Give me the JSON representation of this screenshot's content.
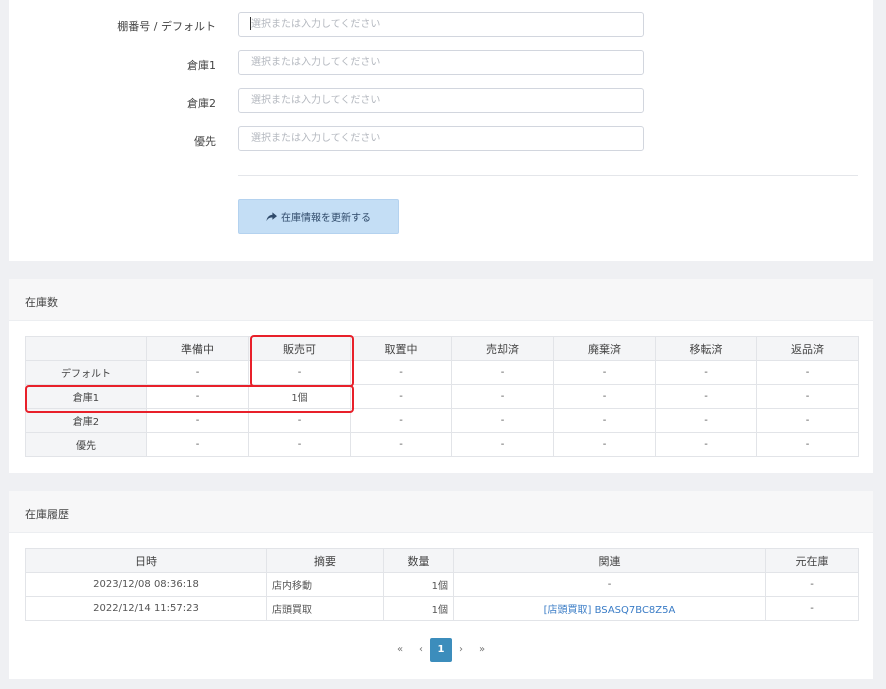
{
  "form": {
    "fields": [
      {
        "label": "棚番号 / デフォルト",
        "placeholder": "選択または入力してください",
        "value": ""
      },
      {
        "label": "倉庫1",
        "placeholder": "選択または入力してください",
        "value": ""
      },
      {
        "label": "倉庫2",
        "placeholder": "選択または入力してください",
        "value": ""
      },
      {
        "label": "優先",
        "placeholder": "選択または入力してください",
        "value": ""
      }
    ],
    "update_button": {
      "label": "在庫情報を更新する",
      "icon": "share-arrow-icon"
    }
  },
  "stock": {
    "title": "在庫数",
    "columns": [
      "",
      "準備中",
      "販売可",
      "取置中",
      "売却済",
      "廃棄済",
      "移転済",
      "返品済"
    ],
    "rows": [
      {
        "label": "デフォルト",
        "cells": [
          "-",
          "-",
          "-",
          "-",
          "-",
          "-",
          "-"
        ]
      },
      {
        "label": "倉庫1",
        "cells": [
          "-",
          "1個",
          "-",
          "-",
          "-",
          "-",
          "-"
        ]
      },
      {
        "label": "倉庫2",
        "cells": [
          "-",
          "-",
          "-",
          "-",
          "-",
          "-",
          "-"
        ]
      },
      {
        "label": "優先",
        "cells": [
          "-",
          "-",
          "-",
          "-",
          "-",
          "-",
          "-"
        ]
      }
    ],
    "highlight_color": "#e8202a"
  },
  "history": {
    "title": "在庫履歴",
    "columns": [
      "日時",
      "摘要",
      "数量",
      "関連",
      "元在庫"
    ],
    "rows": [
      {
        "datetime": "2023/12/08 08:36:18",
        "summary": "店内移動",
        "qty": "1個",
        "related": "-",
        "origin": "-"
      },
      {
        "datetime": "2022/12/14 11:57:23",
        "summary": "店頭買取",
        "qty": "1個",
        "related": "[店頭買取] BSASQ7BC8Z5A",
        "origin": "-"
      }
    ],
    "pagination": {
      "first": "«",
      "prev": "‹",
      "current": "1",
      "next": "›",
      "last": "»"
    }
  },
  "colors": {
    "accent": "#3c8dbc",
    "link": "#3a7cc6",
    "button_bg": "#c4def5"
  }
}
